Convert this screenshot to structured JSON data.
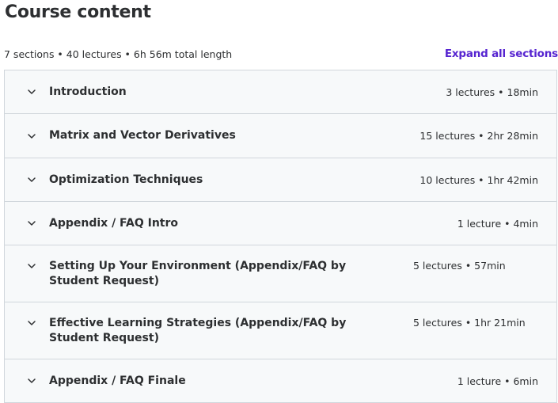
{
  "header": {
    "title": "Course content",
    "summary": "7 sections • 40 lectures • 6h 56m total length",
    "expand_label": "Expand all sections"
  },
  "accent_color": "#5624d0",
  "sections": [
    {
      "title": "Introduction",
      "meta": "3 lectures • 18min"
    },
    {
      "title": "Matrix and Vector Derivatives",
      "meta": "15 lectures • 2hr 28min"
    },
    {
      "title": "Optimization Techniques",
      "meta": "10 lectures • 1hr 42min"
    },
    {
      "title": "Appendix / FAQ Intro",
      "meta": "1 lecture • 4min"
    },
    {
      "title": "Setting Up Your Environment (Appendix/FAQ by Student Request)",
      "meta": "5 lectures • 57min"
    },
    {
      "title": "Effective Learning Strategies (Appendix/FAQ by Student Request)",
      "meta": "5 lectures • 1hr 21min"
    },
    {
      "title": "Appendix / FAQ Finale",
      "meta": "1 lecture • 6min"
    }
  ]
}
